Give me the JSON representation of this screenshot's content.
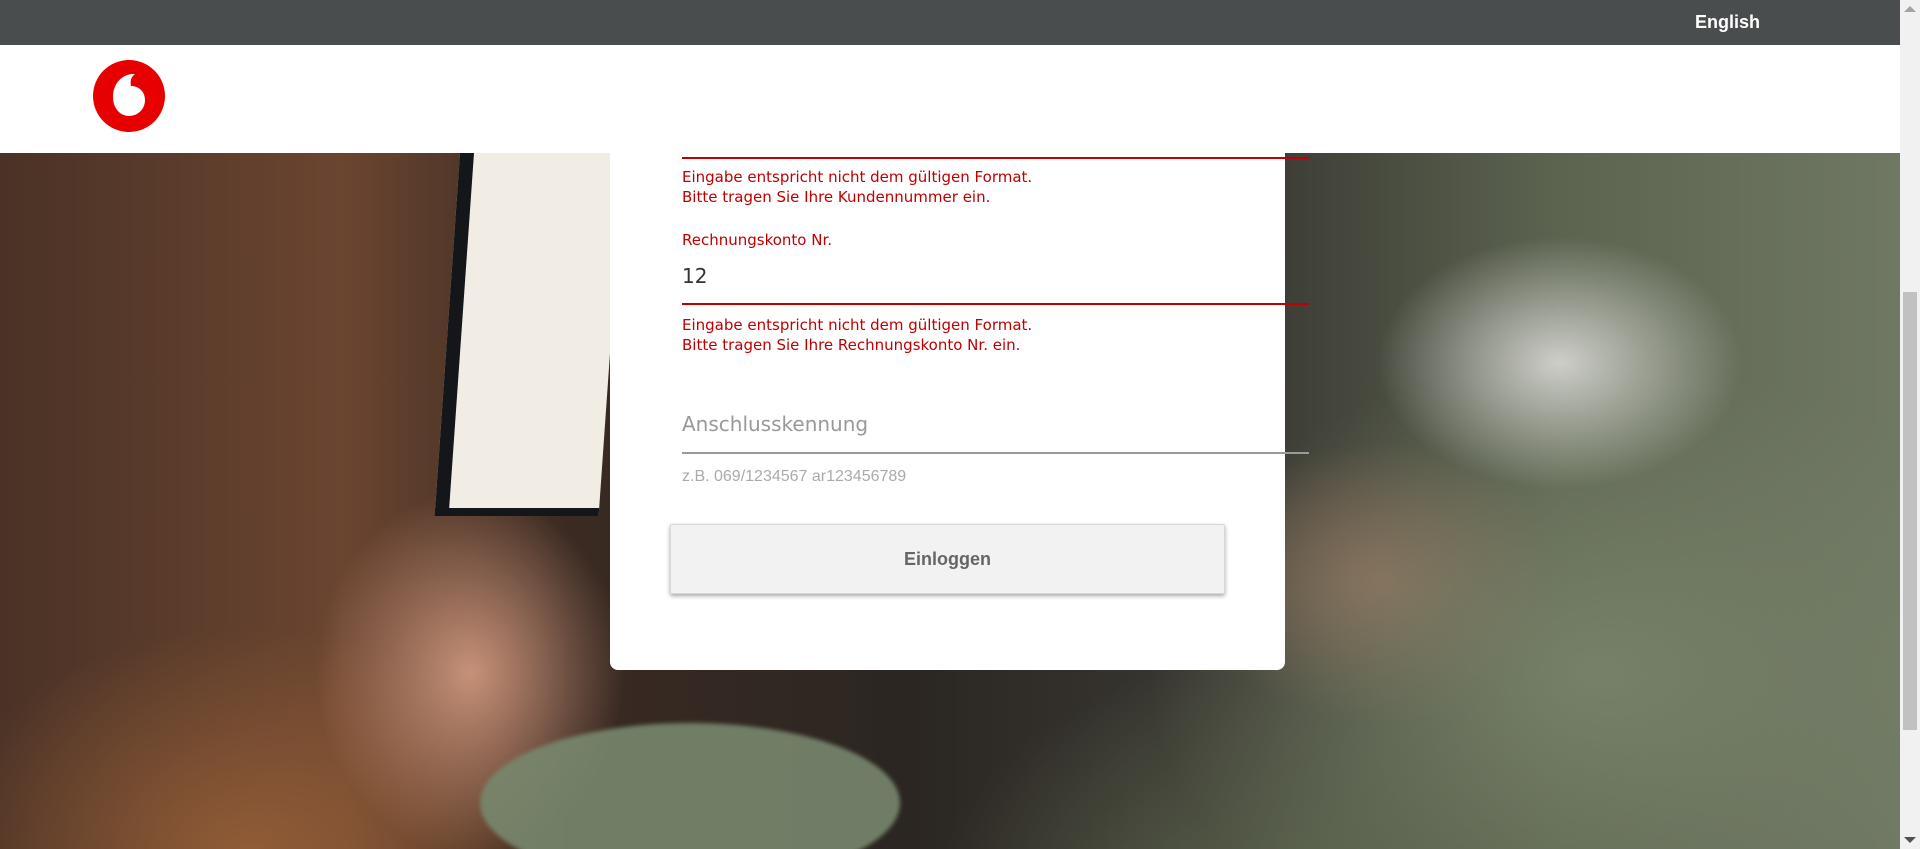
{
  "topbar": {
    "language_link": "English"
  },
  "header": {
    "logo_icon": "vodafone-logo-icon",
    "brand_color": "#e60000"
  },
  "form": {
    "customer_number": {
      "error_line1": "Eingabe entspricht nicht dem gültigen Format.",
      "error_line2": "Bitte tragen Sie Ihre Kundennummer ein."
    },
    "account_number": {
      "label": "Rechnungskonto Nr.",
      "value": "12",
      "error_line1": "Eingabe entspricht nicht dem gültigen Format.",
      "error_line2": "Bitte tragen Sie Ihre Rechnungskonto Nr. ein."
    },
    "connection_id": {
      "placeholder": "Anschlusskennung",
      "hint": "z.B. 069/1234567 ar123456789"
    },
    "login_button": "Einloggen"
  },
  "colors": {
    "error": "#c00000",
    "topbar": "#4a4d4e"
  }
}
